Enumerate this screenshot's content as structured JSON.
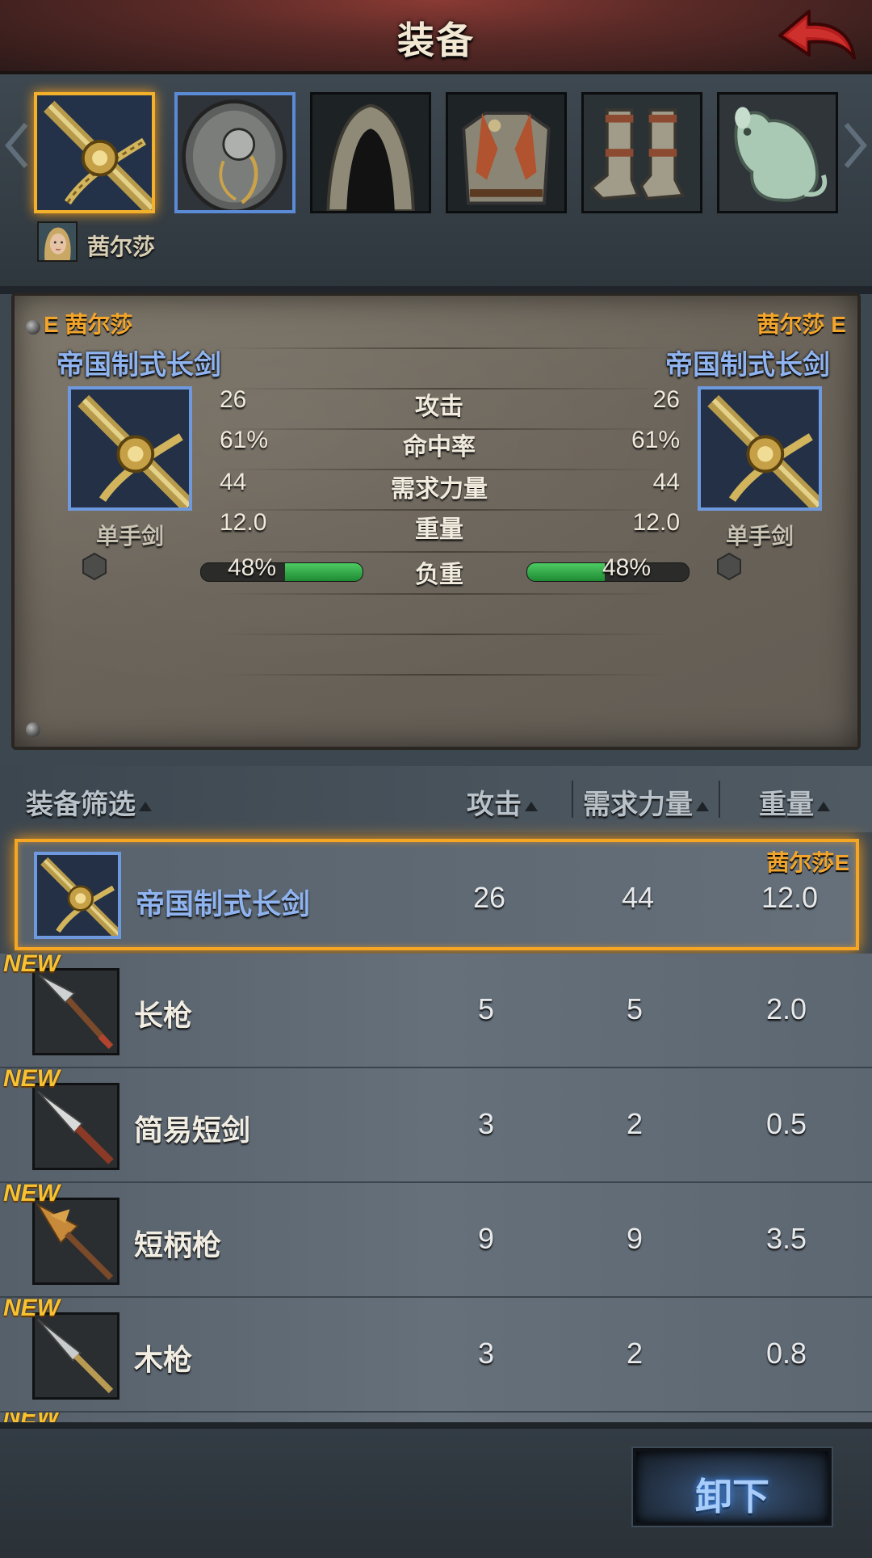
{
  "header": {
    "title": "装备"
  },
  "character": {
    "name": "茜尔莎"
  },
  "slots": [
    {
      "name": "sword",
      "selected": "gold"
    },
    {
      "name": "shield",
      "selected": "blue"
    },
    {
      "name": "hood",
      "selected": "none"
    },
    {
      "name": "armor",
      "selected": "none"
    },
    {
      "name": "boots",
      "selected": "none"
    },
    {
      "name": "jade-mouse",
      "selected": "none"
    }
  ],
  "compare": {
    "left": {
      "tag": "E 茜尔莎",
      "item": "帝国制式长剑",
      "type": "单手剑"
    },
    "right": {
      "tag": "茜尔莎 E",
      "item": "帝国制式长剑",
      "type": "单手剑"
    },
    "stats": [
      {
        "label": "攻击",
        "left": "26",
        "right": "26"
      },
      {
        "label": "命中率",
        "left": "61%",
        "right": "61%"
      },
      {
        "label": "需求力量",
        "left": "44",
        "right": "44"
      },
      {
        "label": "重量",
        "left": "12.0",
        "right": "12.0"
      }
    ],
    "load": {
      "label": "负重",
      "left": "48%",
      "right": "48%",
      "left_fraction": 0.48,
      "right_fraction": 0.48
    }
  },
  "list_header": {
    "filter": "装备筛选",
    "attack": "攻击",
    "strength": "需求力量",
    "weight": "重量"
  },
  "items": [
    {
      "name": "帝国制式长剑",
      "attack": "26",
      "strength": "44",
      "weight": "12.0",
      "owner": "茜尔莎E",
      "is_new": false,
      "selected": true
    },
    {
      "name": "长枪",
      "attack": "5",
      "strength": "5",
      "weight": "2.0",
      "badge": "NEW",
      "is_new": true
    },
    {
      "name": "简易短剑",
      "attack": "3",
      "strength": "2",
      "weight": "0.5",
      "badge": "NEW",
      "is_new": true
    },
    {
      "name": "短柄枪",
      "attack": "9",
      "strength": "9",
      "weight": "3.5",
      "badge": "NEW",
      "is_new": true
    },
    {
      "name": "木枪",
      "attack": "3",
      "strength": "2",
      "weight": "0.8",
      "badge": "NEW",
      "is_new": true
    }
  ],
  "partial_badge": "NEW",
  "footer": {
    "unequip": "卸下"
  },
  "colors": {
    "accent_gold": "#f5a623",
    "item_blue": "#8fb3ef",
    "load_green": "#2fae48"
  }
}
